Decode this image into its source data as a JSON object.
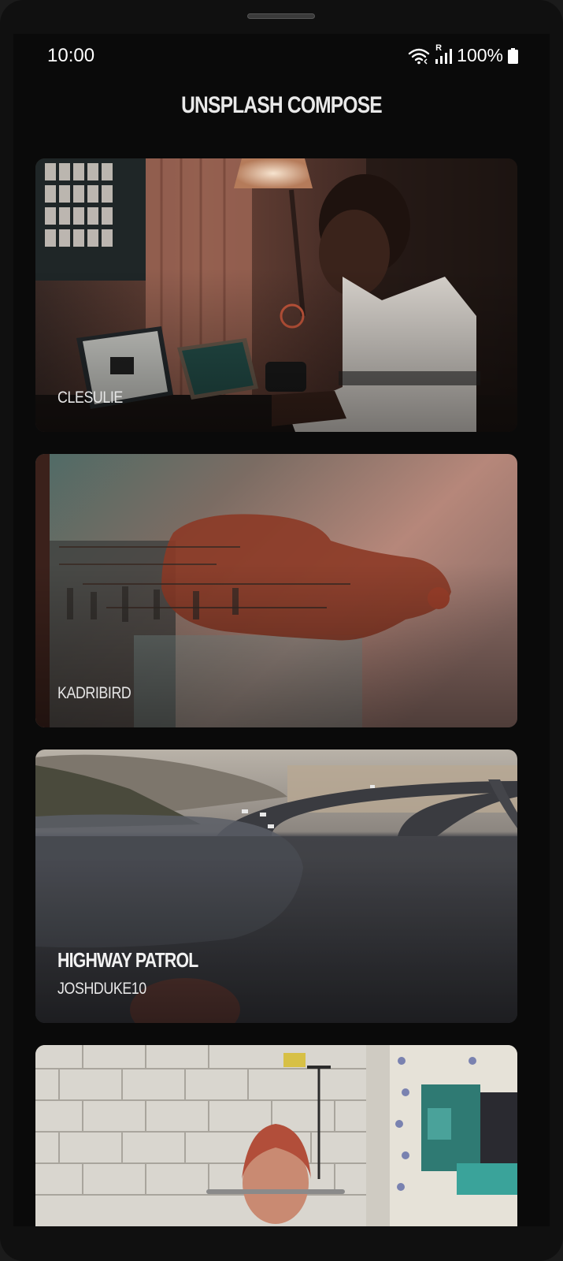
{
  "status_bar": {
    "time": "10:00",
    "battery": "100%",
    "signal_label": "R",
    "icons": [
      "wifi-icon",
      "signal-icon",
      "battery-icon"
    ]
  },
  "app": {
    "title": "UNSPLASH COMPOSE"
  },
  "photos": [
    {
      "title": "",
      "author": "CLESULIE"
    },
    {
      "title": "",
      "author": "KADRIBIRD"
    },
    {
      "title": "HIGHWAY PATROL",
      "author": "JOSHDUKE10"
    },
    {
      "title": "",
      "author": ""
    }
  ],
  "colors": {
    "background": "#0a0a0a",
    "text": "#e9e9e9"
  }
}
